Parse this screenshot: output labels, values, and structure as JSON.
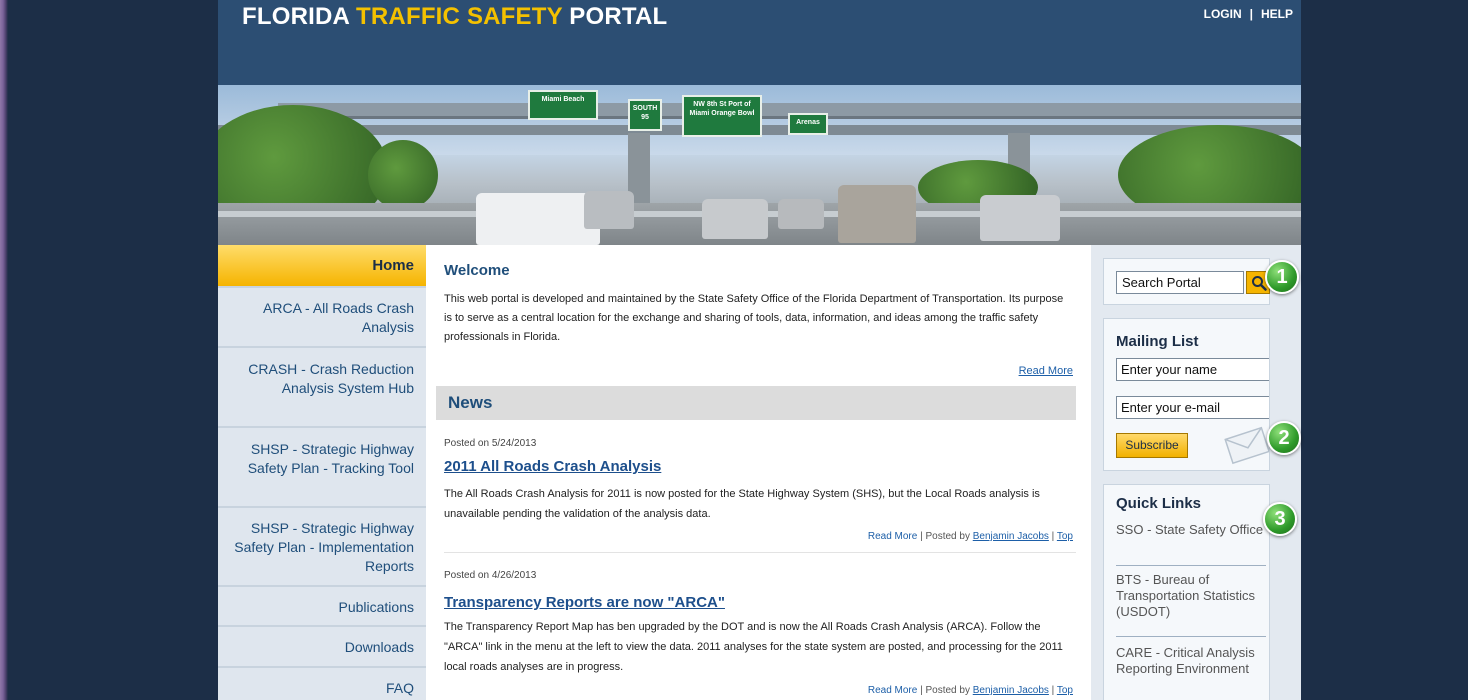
{
  "header": {
    "title_part1": "FLORIDA ",
    "title_part2": "TRAFFIC SAFETY",
    "title_part3": " PORTAL",
    "login": "LOGIN",
    "separator": "|",
    "help": "HELP"
  },
  "banner": {
    "signs": [
      "Miami Beach",
      "SOUTH 95",
      "NW 8th St Port of Miami Orange Bowl",
      "Arenas"
    ]
  },
  "nav": {
    "items": [
      {
        "label": "Home"
      },
      {
        "label": "ARCA - All Roads Crash Analysis"
      },
      {
        "label": "CRASH - Crash Reduction Analysis System Hub"
      },
      {
        "label": "SHSP - Strategic Highway Safety Plan - Tracking Tool"
      },
      {
        "label": "SHSP - Strategic Highway Safety Plan - Implementation Reports"
      },
      {
        "label": "Publications"
      },
      {
        "label": "Downloads"
      },
      {
        "label": "FAQ"
      }
    ]
  },
  "welcome": {
    "title": "Welcome",
    "text": "This web portal is developed and maintained by the State Safety Office of the Florida Department of Transportation. Its purpose is to serve as a central location for the exchange and sharing of tools, data, information, and ideas among the traffic safety professionals in Florida.",
    "read_more": "Read More"
  },
  "news": {
    "title": "News",
    "articles": [
      {
        "posted": "Posted on 5/24/2013",
        "title": "2011 All Roads Crash Analysis",
        "text": "The All Roads Crash Analysis for 2011 is now posted for the State Highway System (SHS), but the Local Roads analysis is unavailable pending the validation of the analysis data.",
        "read_more": "Read More",
        "sep1": " | Posted by ",
        "author": "Benjamin Jacobs",
        "sep2": " | ",
        "top": "Top"
      },
      {
        "posted": "Posted on 4/26/2013",
        "title": "Transparency Reports are now \"ARCA\"",
        "text": "The Transparency Report Map has ben upgraded by the DOT and is now the All Roads Crash Analysis (ARCA). Follow the \"ARCA\" link in the menu at the left to view the data. 2011 analyses for the state system are posted, and processing for the 2011 local roads analyses are in progress.",
        "read_more": "Read More",
        "sep1": " | Posted by ",
        "author": "Benjamin Jacobs",
        "sep2": " | ",
        "top": "Top"
      }
    ]
  },
  "sidebar": {
    "search_value": "Search Portal",
    "mailing_title": "Mailing List",
    "name_value": "Enter your name",
    "email_value": "Enter your e-mail",
    "subscribe": "Subscribe",
    "quick_links_title": "Quick Links",
    "quick_links": [
      "SSO - State Safety Office",
      "BTS - Bureau of Transportation Statistics (USDOT)",
      "CARE - Critical Analysis Reporting Environment"
    ]
  },
  "badges": [
    "1",
    "2",
    "3"
  ],
  "colors": {
    "background": "#1c2e47",
    "header": "#2c4e73",
    "accent_yellow": "#f4c100",
    "link_blue": "#1d5fa8",
    "badge_green": "#2e9a2a"
  }
}
